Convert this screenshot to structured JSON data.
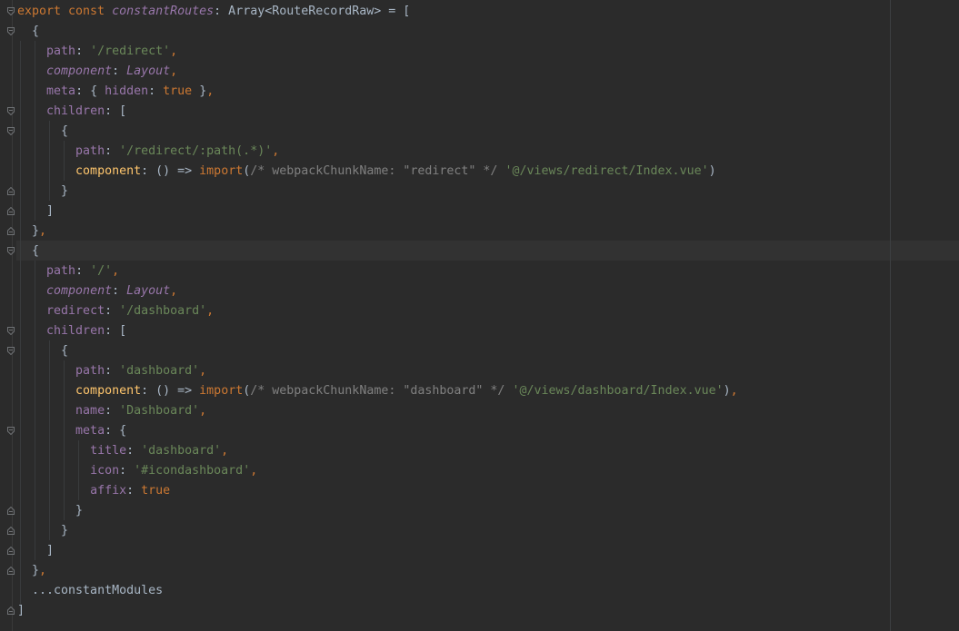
{
  "code": {
    "l1": {
      "kw": "export const",
      "name": "constantRoutes",
      "rest": ": Array<RouteRecordRaw> = ["
    },
    "l2": "{",
    "l3": {
      "key": "path",
      "val": "'/redirect'"
    },
    "l4": {
      "key": "component",
      "val": "Layout"
    },
    "l5": {
      "key": "meta",
      "inner_key": "hidden",
      "inner_val": "true"
    },
    "l6": {
      "key": "children",
      "val": "["
    },
    "l7": "{",
    "l8": {
      "key": "path",
      "val": "'/redirect/:path(.*)'"
    },
    "l9": {
      "key": "component",
      "arrow": "() =>",
      "fn": "import",
      "comment": "/* webpackChunkName: \"redirect\" */",
      "val": "'@/views/redirect/Index.vue'"
    },
    "l10": "}",
    "l11": "]",
    "l12": "}",
    "l13": "{",
    "l14": {
      "key": "path",
      "val": "'/'"
    },
    "l15": {
      "key": "component",
      "val": "Layout"
    },
    "l16": {
      "key": "redirect",
      "val": "'/dashboard'"
    },
    "l17": {
      "key": "children",
      "val": "["
    },
    "l18": "{",
    "l19": {
      "key": "path",
      "val": "'dashboard'"
    },
    "l20": {
      "key": "component",
      "arrow": "() =>",
      "fn": "import",
      "comment": "/* webpackChunkName: \"dashboard\" */",
      "val": "'@/views/dashboard/Index.vue'"
    },
    "l21": {
      "key": "name",
      "val": "'Dashboard'"
    },
    "l22": {
      "key": "meta",
      "val": "{"
    },
    "l23": {
      "key": "title",
      "val": "'dashboard'"
    },
    "l24": {
      "key": "icon",
      "val": "'#icondashboard'"
    },
    "l25": {
      "key": "affix",
      "val": "true"
    },
    "l26": "}",
    "l27": "}",
    "l28": "]",
    "l29": "}",
    "l30": "...constantModules",
    "l31": "]"
  },
  "colors": {
    "background": "#2b2b2b",
    "keyword": "#cc7832",
    "property": "#9876aa",
    "string": "#6a8759",
    "comment": "#808080",
    "function": "#ffc66d",
    "text": "#a9b7c6"
  },
  "icons": {
    "fold_marker": "fold-marker-icon"
  }
}
